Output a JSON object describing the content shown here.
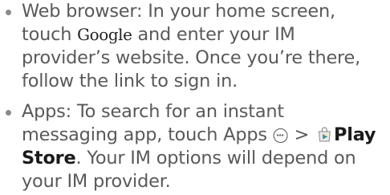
{
  "bullets": [
    {
      "line1": "Web browser: In your home screen,",
      "line2_pre": "touch ",
      "line2_google": "Google",
      "line2_post": " and enter your IM",
      "line3": "provider’s website. Once you’re there,",
      "line4": "follow the link to sign in."
    },
    {
      "line1": "Apps: To search for an instant",
      "line2_pre": "messaging app, touch Apps ",
      "line2_sep": " > ",
      "line2_bold": "Play",
      "line3_bold": "Store",
      "line3_post": ". Your IM options will depend on",
      "line4": "your IM provider."
    }
  ],
  "icons": {
    "apps": "apps-icon",
    "play_store": "play-store-icon"
  }
}
